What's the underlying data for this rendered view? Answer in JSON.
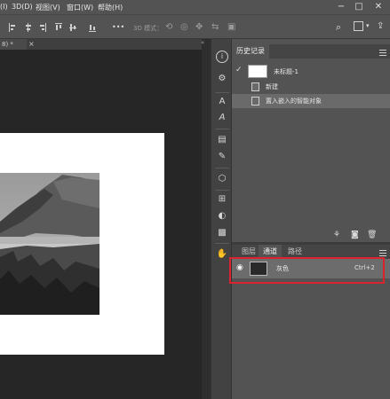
{
  "menubar": {
    "items": [
      "(I)",
      "3D(D)",
      "视图(V)",
      "窗口(W)",
      "帮助(H)"
    ],
    "window_controls": [
      "−",
      "□",
      "✕"
    ]
  },
  "optionsbar": {
    "mode_label": "3D 模式：",
    "more_label": "•••"
  },
  "document": {
    "tab_label": "8) *",
    "tab_close": "×"
  },
  "history_panel": {
    "title": "历史记录",
    "snapshot_label": "未标题-1",
    "steps": [
      "新建",
      "置入嵌入的智能对象"
    ]
  },
  "layers_panel": {
    "tabs": [
      "图层",
      "通道",
      "路径"
    ],
    "active_tab": "通道",
    "channel": {
      "name": "灰色",
      "shortcut": "Ctrl+2"
    }
  },
  "colors": {
    "highlight_border": "#d9232e",
    "menubar_bg": "#535353"
  },
  "toolbar_icons": [
    "info-icon",
    "properties-icon",
    "character-icon",
    "paragraph-icon",
    "libraries-icon",
    "notes-icon",
    "3d-icon",
    "adjustments-icon",
    "styles-icon",
    "swatches-icon",
    "brush-icon"
  ]
}
